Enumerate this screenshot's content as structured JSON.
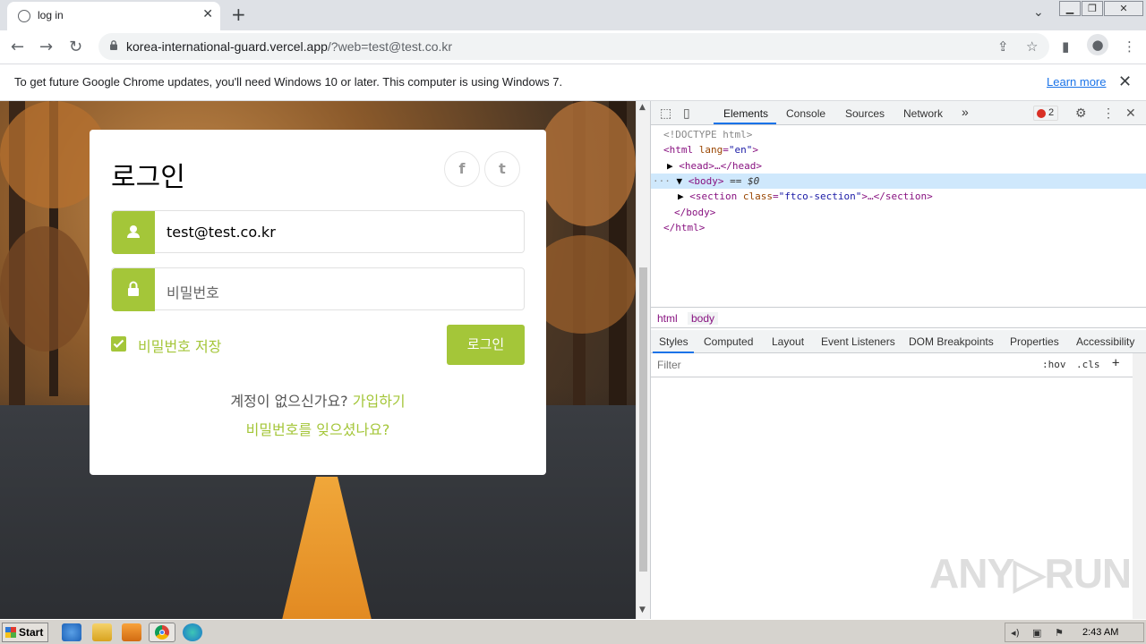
{
  "browser": {
    "tab_title": "log in",
    "new_tab_icon": "+",
    "url_host": "korea-international-guard.vercel.app",
    "url_rest": "/?web=test@test.co.kr"
  },
  "infobar": {
    "message": "To get future Google Chrome updates, you'll need Windows 10 or later. This computer is using Windows 7.",
    "learn_more": "Learn more"
  },
  "login": {
    "heading": "로그인",
    "social": [
      "f",
      "t"
    ],
    "email_value": "test@test.co.kr",
    "password_placeholder": "비밀번호",
    "remember_label": "비밀번호 저장",
    "remember_checked": true,
    "submit_label": "로그인",
    "no_account": "계정이 없으신가요?",
    "signup_link": "가입하기",
    "forgot_link": "비밀번호를 잊으셨나요?"
  },
  "devtools": {
    "tabs": [
      "Elements",
      "Console",
      "Sources",
      "Network",
      "»"
    ],
    "active_tab": "Elements",
    "error_count": "2",
    "dom": {
      "doctype": "<!DOCTYPE html>",
      "html_open_tag": "<html",
      "html_attr": "lang",
      "html_attr_val": "\"en\"",
      "head": "<head>…</head>",
      "body_tag": "<body>",
      "body_eq": "== $0",
      "section_tag": "<section",
      "section_attr": "class",
      "section_attr_val": "\"ftco-section\"",
      "section_close": ">…</section>",
      "body_close": "</body>",
      "html_close": "</html>",
      "ellipsis": "···"
    },
    "breadcrumbs": [
      "html",
      "body"
    ],
    "sub_tabs": [
      "Styles",
      "Computed",
      "Layout",
      "Event Listeners",
      "DOM Breakpoints",
      "Properties",
      "Accessibility"
    ],
    "filter_placeholder": "Filter",
    "hov": ":hov",
    "cls": ".cls",
    "plus": "+"
  },
  "watermark": "ANY▷RUN",
  "taskbar": {
    "start_label": "Start",
    "clock": "2:43 AM"
  }
}
